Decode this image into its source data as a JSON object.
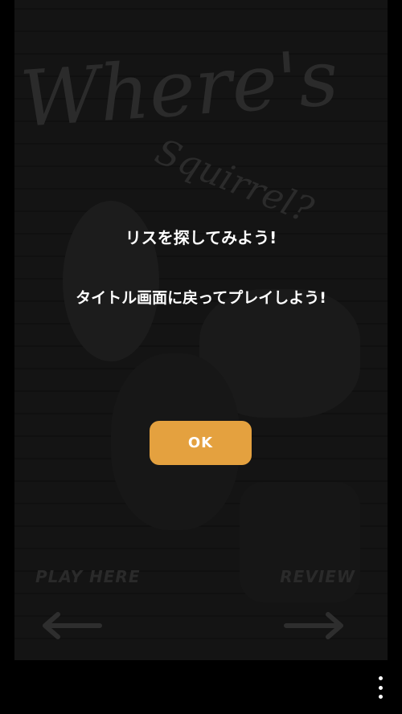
{
  "background": {
    "title_line1": "Where's",
    "title_line2": "Squirrel?",
    "left_label": "PLAY HERE",
    "right_label": "REVIEW",
    "left_arrow_icon": "arrow-left-icon",
    "right_arrow_icon": "arrow-right-icon"
  },
  "dialog": {
    "message_1": "リスを探してみよう!",
    "message_2": "タイトル画面に戻ってプレイしよう!",
    "ok_label": "OK"
  },
  "nav_bar": {
    "menu_icon": "more-vertical-icon"
  },
  "colors": {
    "accent": "#e4a13f",
    "dialog_text": "#ffffff",
    "background": "#000000"
  }
}
